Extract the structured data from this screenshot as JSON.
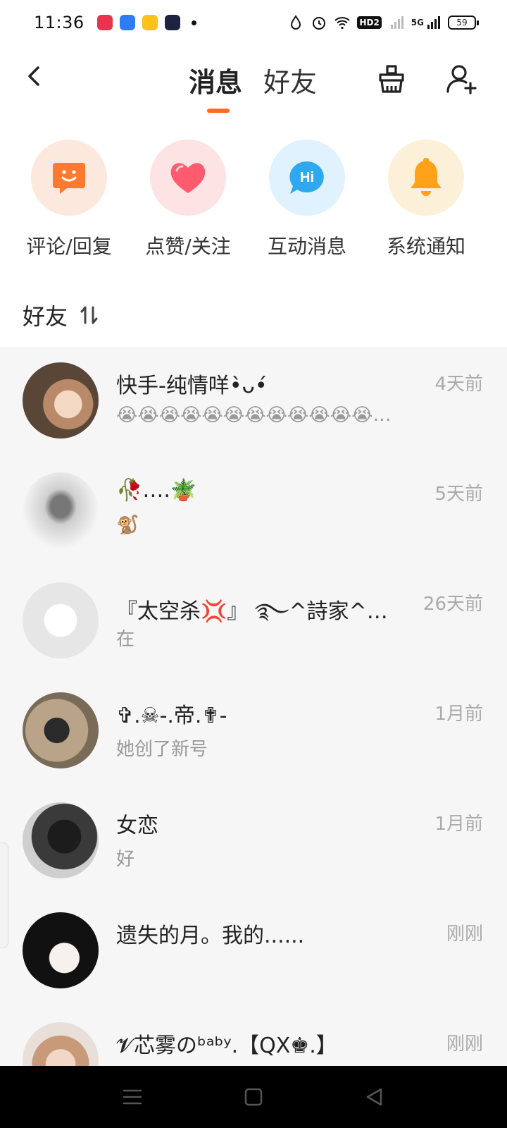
{
  "status_bar": {
    "time": "11:36",
    "network": "5G",
    "hd_badge": "HD2",
    "battery": "59"
  },
  "top_nav": {
    "tabs": [
      "消息",
      "好友"
    ],
    "active_tab": "消息",
    "accent_color": "#ff6a22"
  },
  "quick_actions": [
    {
      "label": "评论/回复",
      "icon": "smile-chat-icon",
      "bg": "#fde8de",
      "fg": "#ff7a2f"
    },
    {
      "label": "点赞/关注",
      "icon": "heart-icon",
      "bg": "#fde3e3",
      "fg": "#ff5a6e"
    },
    {
      "label": "互动消息",
      "icon": "hi-bubble-icon",
      "bg": "#dff2fd",
      "fg": "#2ea9f0"
    },
    {
      "label": "系统通知",
      "icon": "bell-icon",
      "bg": "#fdf0d8",
      "fg": "#ffa21a"
    }
  ],
  "section": {
    "title": "好友"
  },
  "conversations": [
    {
      "name": "快手-纯情咩•̀ᴗ•́",
      "message": "😭😭😭😭😭😭😭😭😭😭😭😭…",
      "time": "4天前"
    },
    {
      "name": "🥀….🪴",
      "message": "🐒",
      "time": "5天前"
    },
    {
      "name": "『太空杀💢』 ࿐^詩家^…",
      "message": "在",
      "time": "26天前"
    },
    {
      "name": "✞.☠-.帝.✟-",
      "message": "她创了新号",
      "time": "1月前"
    },
    {
      "name": "女恋",
      "message": "好",
      "time": "1月前"
    },
    {
      "name": "遗失的月。我的......",
      "message": "",
      "time": "刚刚"
    },
    {
      "name": "𝓥芯雾のᵇᵃᵇʸ.【QX♚.】",
      "message": "",
      "time": "刚刚"
    }
  ]
}
